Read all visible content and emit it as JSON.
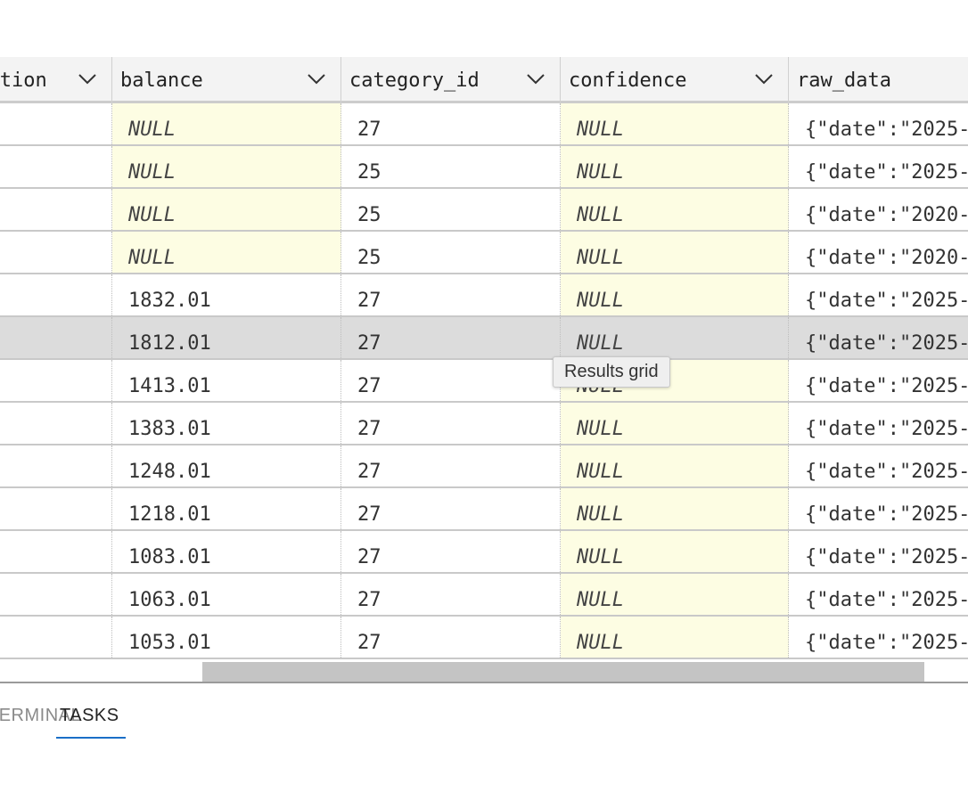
{
  "grid": {
    "columns": [
      {
        "label": "description"
      },
      {
        "label": "balance"
      },
      {
        "label": "category_id"
      },
      {
        "label": "confidence"
      },
      {
        "label": "raw_data"
      }
    ],
    "rows": [
      {
        "balance": "NULL",
        "category_id": "27",
        "confidence": "NULL",
        "raw_data": "{\"date\":\"2025-"
      },
      {
        "balance": "NULL",
        "category_id": "25",
        "confidence": "NULL",
        "raw_data": "{\"date\":\"2025-"
      },
      {
        "balance": "NULL",
        "category_id": "25",
        "confidence": "NULL",
        "raw_data": "{\"date\":\"2020-"
      },
      {
        "balance": "NULL",
        "category_id": "25",
        "confidence": "NULL",
        "raw_data": "{\"date\":\"2020-"
      },
      {
        "balance": "1832.01",
        "category_id": "27",
        "confidence": "NULL",
        "raw_data": "{\"date\":\"2025-"
      },
      {
        "balance": "1812.01",
        "category_id": "27",
        "confidence": "NULL",
        "raw_data": "{\"date\":\"2025-"
      },
      {
        "balance": "1413.01",
        "category_id": "27",
        "confidence": "NULL",
        "raw_data": "{\"date\":\"2025-"
      },
      {
        "balance": "1383.01",
        "category_id": "27",
        "confidence": "NULL",
        "raw_data": "{\"date\":\"2025-"
      },
      {
        "balance": "1248.01",
        "category_id": "27",
        "confidence": "NULL",
        "raw_data": "{\"date\":\"2025-"
      },
      {
        "balance": "1218.01",
        "category_id": "27",
        "confidence": "NULL",
        "raw_data": "{\"date\":\"2025-"
      },
      {
        "balance": "1083.01",
        "category_id": "27",
        "confidence": "NULL",
        "raw_data": "{\"date\":\"2025-"
      },
      {
        "balance": "1063.01",
        "category_id": "27",
        "confidence": "NULL",
        "raw_data": "{\"date\":\"2025-"
      },
      {
        "balance": "1053.01",
        "category_id": "27",
        "confidence": "NULL",
        "raw_data": "{\"date\":\"2025-"
      }
    ],
    "selected_row": 5,
    "null_label": "NULL"
  },
  "tooltip": {
    "text": "Results grid"
  },
  "bottom_tabs": {
    "terminal": "TERMINAL",
    "tasks": "TASKS"
  },
  "colors": {
    "null_highlight": "#fdfde3",
    "selected_row": "#dcdcdc",
    "active_tab_underline": "#1a6fc7"
  },
  "icons": {
    "column_menu": "chevron-down-icon"
  }
}
